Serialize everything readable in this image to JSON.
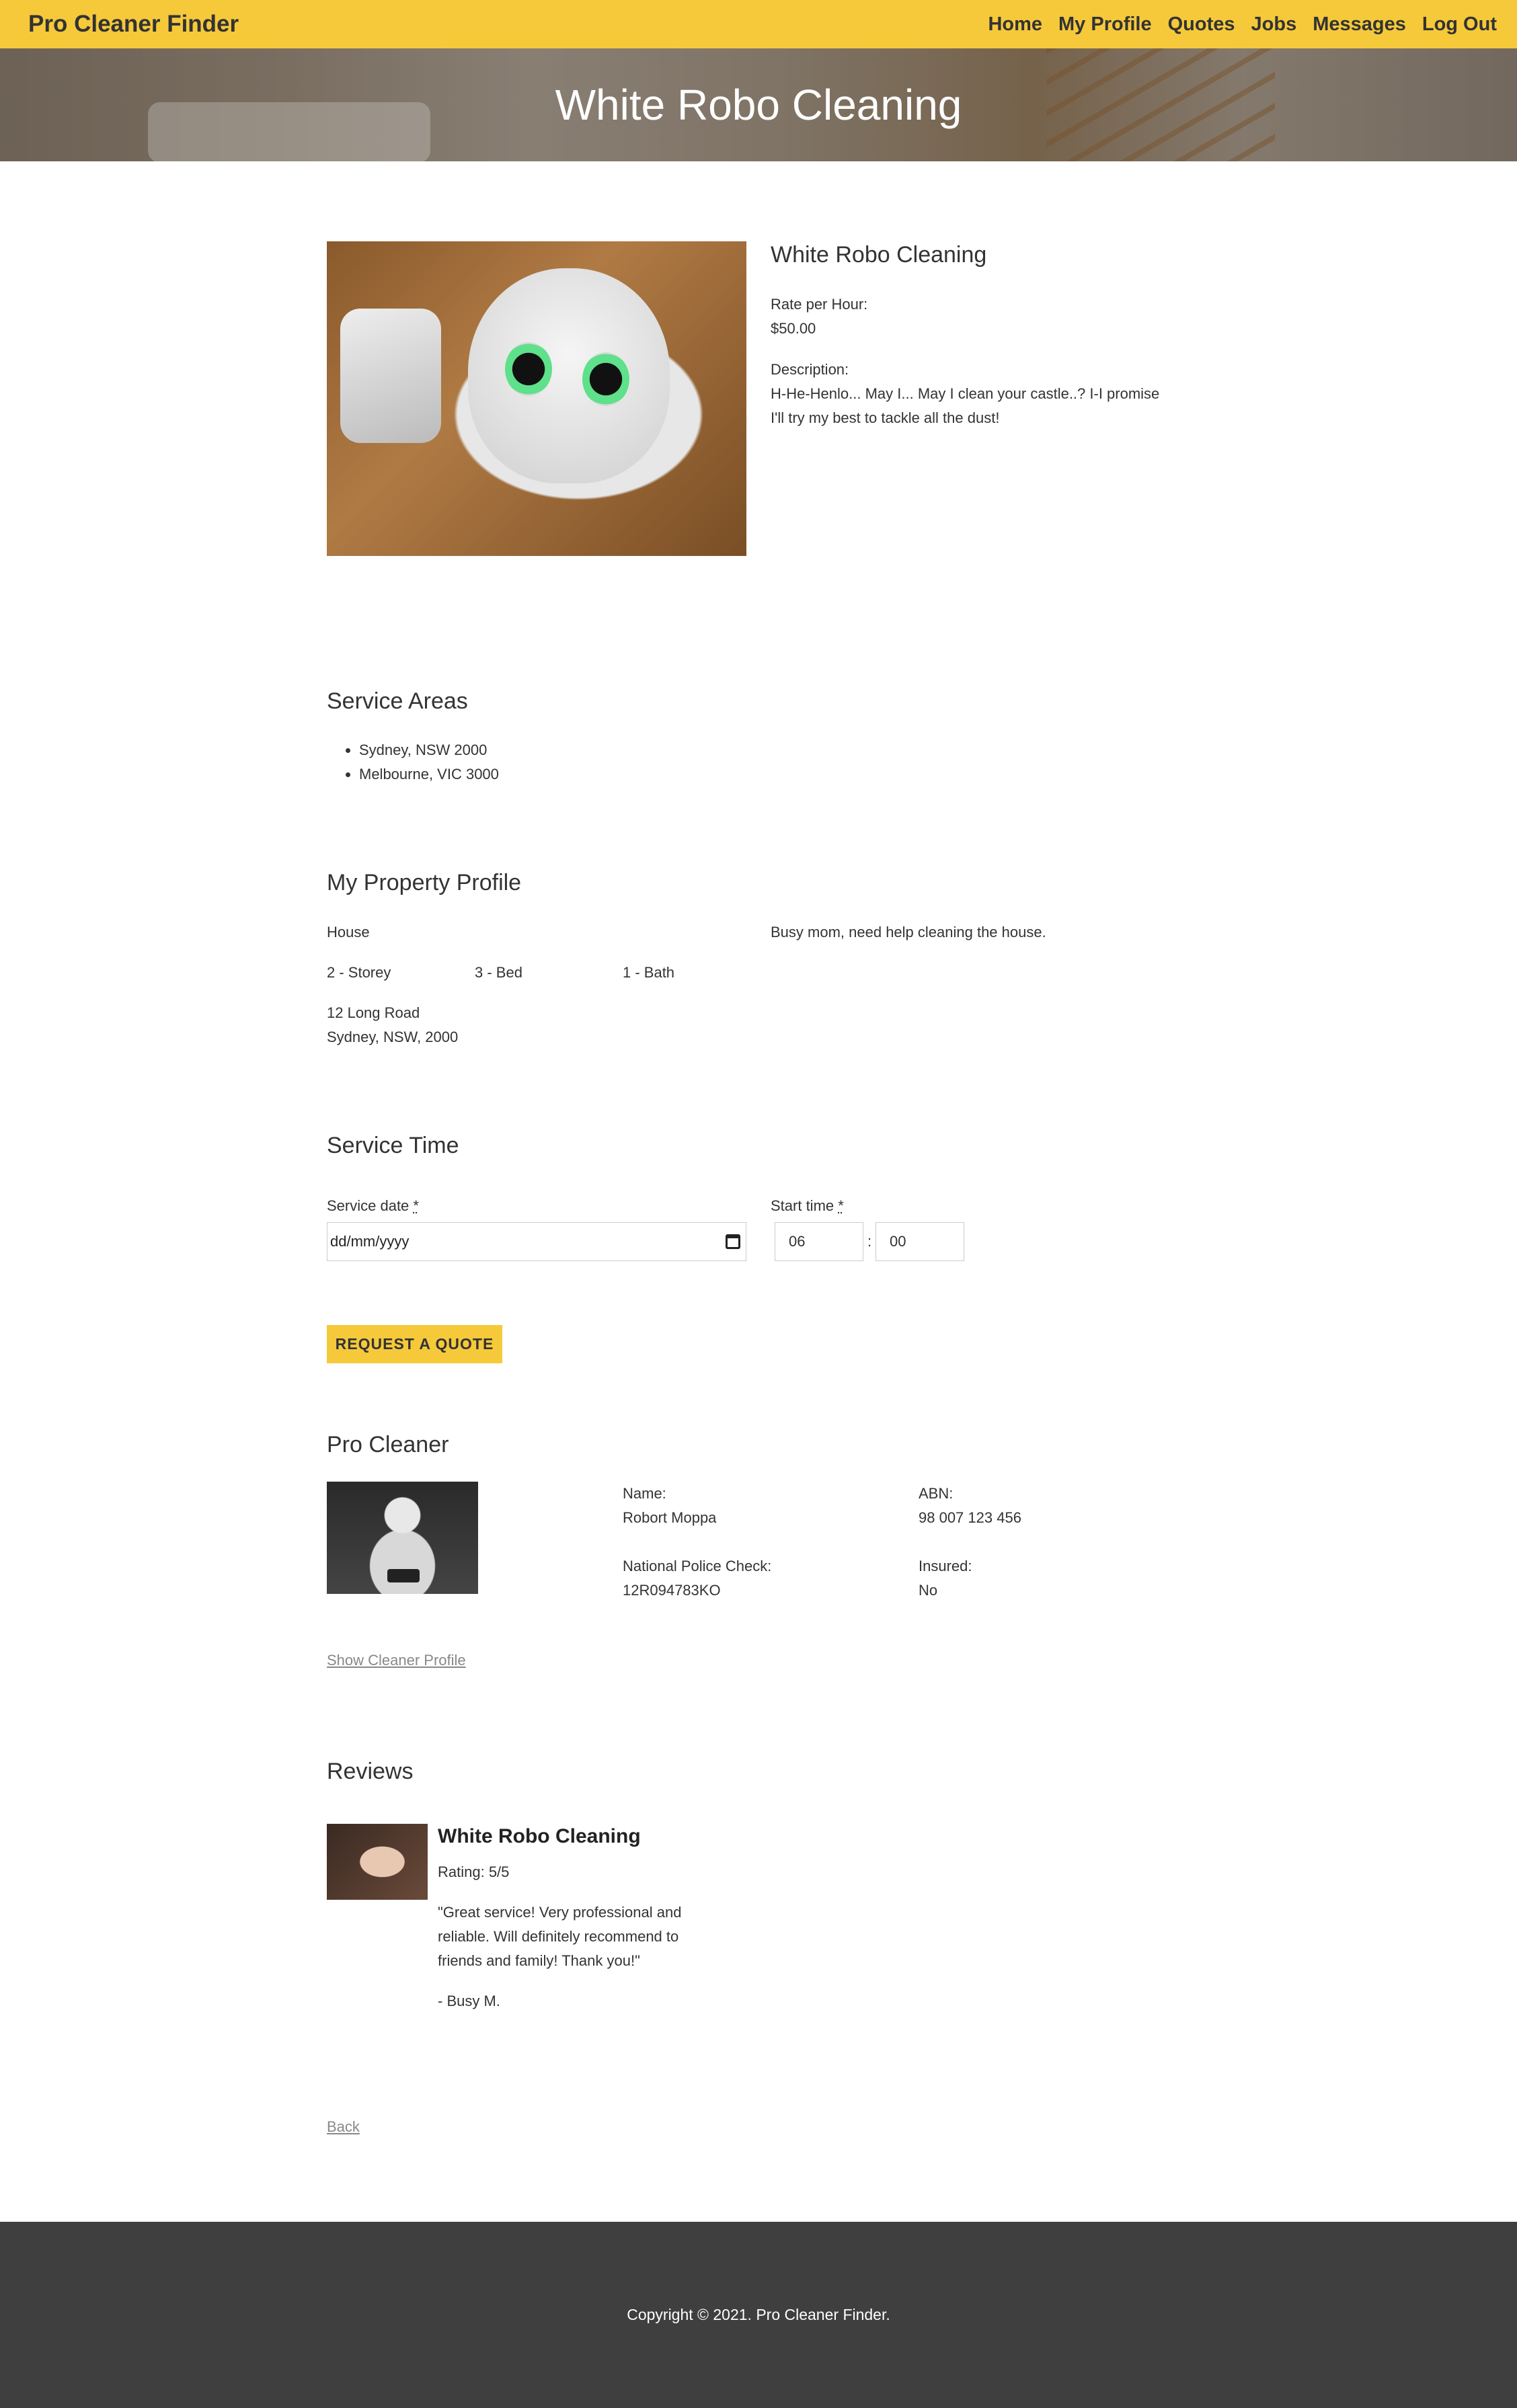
{
  "nav": {
    "brand": "Pro Cleaner Finder",
    "links": [
      "Home",
      "My Profile",
      "Quotes",
      "Jobs",
      "Messages",
      "Log Out"
    ]
  },
  "hero": {
    "title": "White Robo Cleaning"
  },
  "listing": {
    "name": "White Robo Cleaning",
    "rate_label": "Rate per Hour:",
    "rate_value": "$50.00",
    "description_label": "Description:",
    "description_line1": "H-He-Henlo... May I... May I clean your castle..? I-I promise",
    "description_line2": "I'll try my best to tackle all the dust!"
  },
  "service_areas": {
    "heading": "Service Areas",
    "items": [
      "Sydney, NSW 2000",
      "Melbourne, VIC 3000"
    ]
  },
  "property": {
    "heading": "My Property Profile",
    "type": "House",
    "storey": "2 - Storey",
    "bed": "3 - Bed",
    "bath": "1 - Bath",
    "address_line1": "12 Long Road",
    "address_line2": "Sydney, NSW, 2000",
    "note": "Busy mom, need help cleaning the house."
  },
  "service_time": {
    "heading": "Service Time",
    "date_label": "Service date",
    "time_label": "Start time",
    "required_mark": "*",
    "date_placeholder": "dd/mm/yyyy",
    "hour": "06",
    "separator": ":",
    "minute": "00"
  },
  "quote_button": "REQUEST A QUOTE",
  "cleaner": {
    "heading": "Pro Cleaner",
    "name_label": "Name:",
    "name": "Robort Moppa",
    "abn_label": "ABN:",
    "abn": "98 007 123 456",
    "police_label": "National Police Check:",
    "police": "12R094783KO",
    "insured_label": "Insured:",
    "insured": "No",
    "profile_link": "Show Cleaner Profile"
  },
  "reviews": {
    "heading": "Reviews",
    "items": [
      {
        "title": "White Robo Cleaning",
        "rating": "Rating: 5/5",
        "text_line1": "\"Great service! Very professional and",
        "text_line2": "reliable. Will definitely recommend to",
        "text_line3": "friends and family! Thank you!\"",
        "author": "- Busy M."
      }
    ]
  },
  "back_link": "Back",
  "footer": {
    "copyright": "Copyright © 2021. Pro Cleaner Finder."
  },
  "colors": {
    "accent": "#f5c93a",
    "footer": "#3f3f3f",
    "link": "#888888"
  }
}
